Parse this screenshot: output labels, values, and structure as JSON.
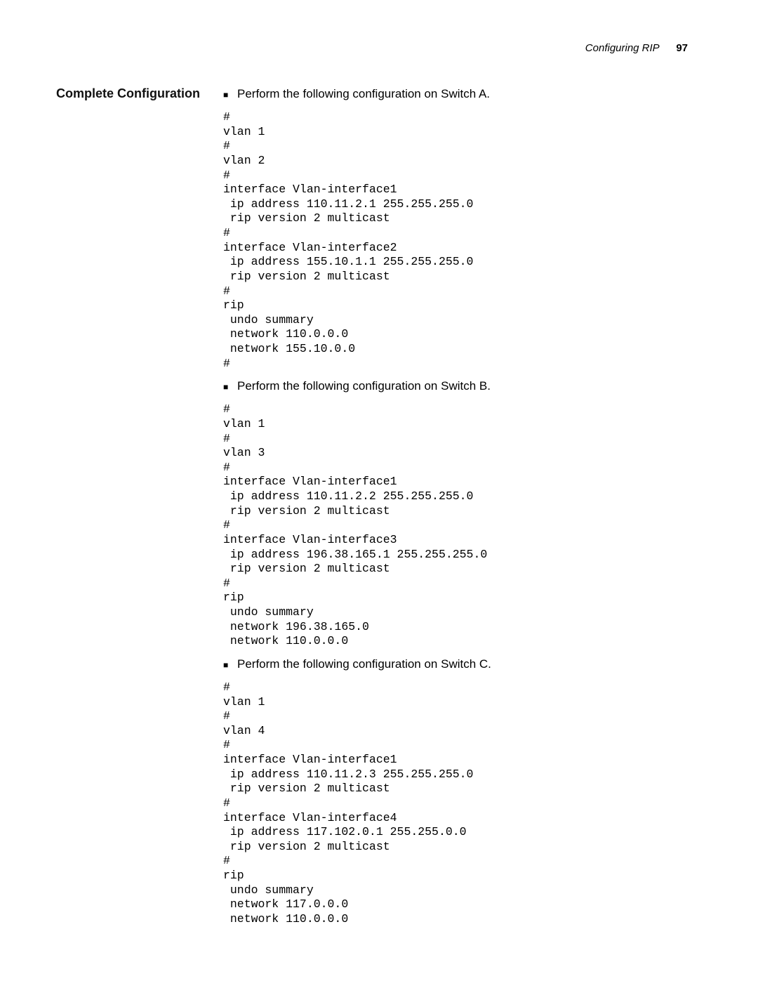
{
  "header": {
    "running_title": "Configuring RIP",
    "page_number": "97"
  },
  "side_heading": "Complete Configuration",
  "sections": [
    {
      "intro": "Perform the following configuration on Switch A.",
      "code": "#\nvlan 1\n#\nvlan 2\n#\ninterface Vlan-interface1\n ip address 110.11.2.1 255.255.255.0\n rip version 2 multicast\n#\ninterface Vlan-interface2\n ip address 155.10.1.1 255.255.255.0\n rip version 2 multicast\n#\nrip\n undo summary\n network 110.0.0.0\n network 155.10.0.0\n#"
    },
    {
      "intro": "Perform the following configuration on Switch B.",
      "code": "#\nvlan 1\n#\nvlan 3\n#\ninterface Vlan-interface1\n ip address 110.11.2.2 255.255.255.0\n rip version 2 multicast\n#\ninterface Vlan-interface3\n ip address 196.38.165.1 255.255.255.0\n rip version 2 multicast\n#\nrip\n undo summary\n network 196.38.165.0\n network 110.0.0.0"
    },
    {
      "intro": "Perform the following configuration on Switch C.",
      "code": "#\nvlan 1\n#\nvlan 4\n#\ninterface Vlan-interface1\n ip address 110.11.2.3 255.255.255.0\n rip version 2 multicast\n#\ninterface Vlan-interface4\n ip address 117.102.0.1 255.255.0.0\n rip version 2 multicast\n#\nrip\n undo summary\n network 117.0.0.0\n network 110.0.0.0"
    }
  ]
}
